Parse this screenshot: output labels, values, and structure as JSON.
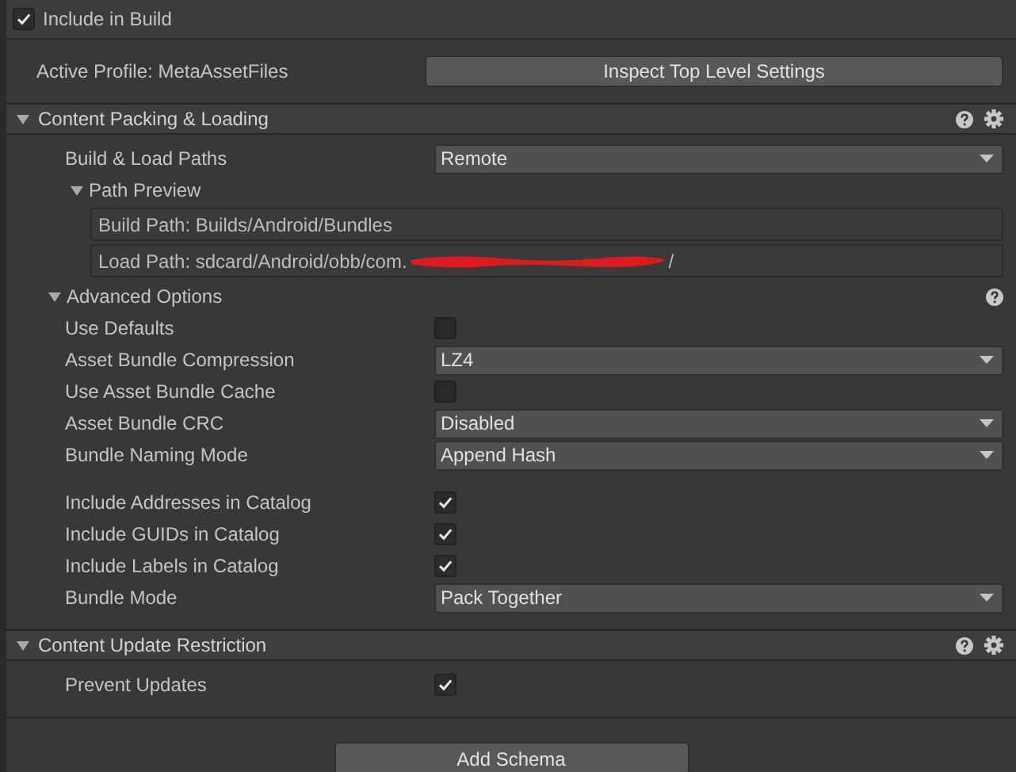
{
  "include_in_build": {
    "label": "Include in Build",
    "checked": true
  },
  "active_profile": {
    "label": "Active Profile: MetaAssetFiles",
    "button": "Inspect Top Level Settings"
  },
  "sections": [
    {
      "title": "Content Packing & Loading",
      "expanded": true,
      "help": true,
      "settings": true,
      "items": [
        {
          "kind": "dropdown",
          "label": "Build & Load Paths",
          "value": "Remote"
        },
        {
          "kind": "foldout",
          "label": "Path Preview",
          "expanded": true,
          "help": false,
          "nested": true,
          "children": [
            {
              "kind": "path",
              "text": "Build Path: Builds/Android/Bundles",
              "redacted": false
            },
            {
              "kind": "path",
              "text": "Load Path: sdcard/Android/obb/com.",
              "redacted": true,
              "suffix": "/"
            }
          ]
        },
        {
          "kind": "foldout",
          "label": "Advanced Options",
          "expanded": true,
          "help": true,
          "nested": false,
          "children": [
            {
              "kind": "checkbox",
              "label": "Use Defaults",
              "checked": false
            },
            {
              "kind": "dropdown",
              "label": "Asset Bundle Compression",
              "value": "LZ4"
            },
            {
              "kind": "checkbox",
              "label": "Use Asset Bundle Cache",
              "checked": false
            },
            {
              "kind": "dropdown",
              "label": "Asset Bundle CRC",
              "value": "Disabled"
            },
            {
              "kind": "dropdown",
              "label": "Bundle Naming Mode",
              "value": "Append Hash"
            },
            {
              "kind": "checkbox",
              "label": "Include Addresses in Catalog",
              "checked": true,
              "spaced": true
            },
            {
              "kind": "checkbox",
              "label": "Include GUIDs in Catalog",
              "checked": true
            },
            {
              "kind": "checkbox",
              "label": "Include Labels in Catalog",
              "checked": true
            },
            {
              "kind": "dropdown",
              "label": "Bundle Mode",
              "value": "Pack Together"
            }
          ]
        }
      ]
    },
    {
      "title": "Content Update Restriction",
      "expanded": true,
      "help": true,
      "settings": true,
      "items": [
        {
          "kind": "checkbox",
          "label": "Prevent Updates",
          "checked": true
        }
      ]
    }
  ],
  "add_button": "Add Schema"
}
